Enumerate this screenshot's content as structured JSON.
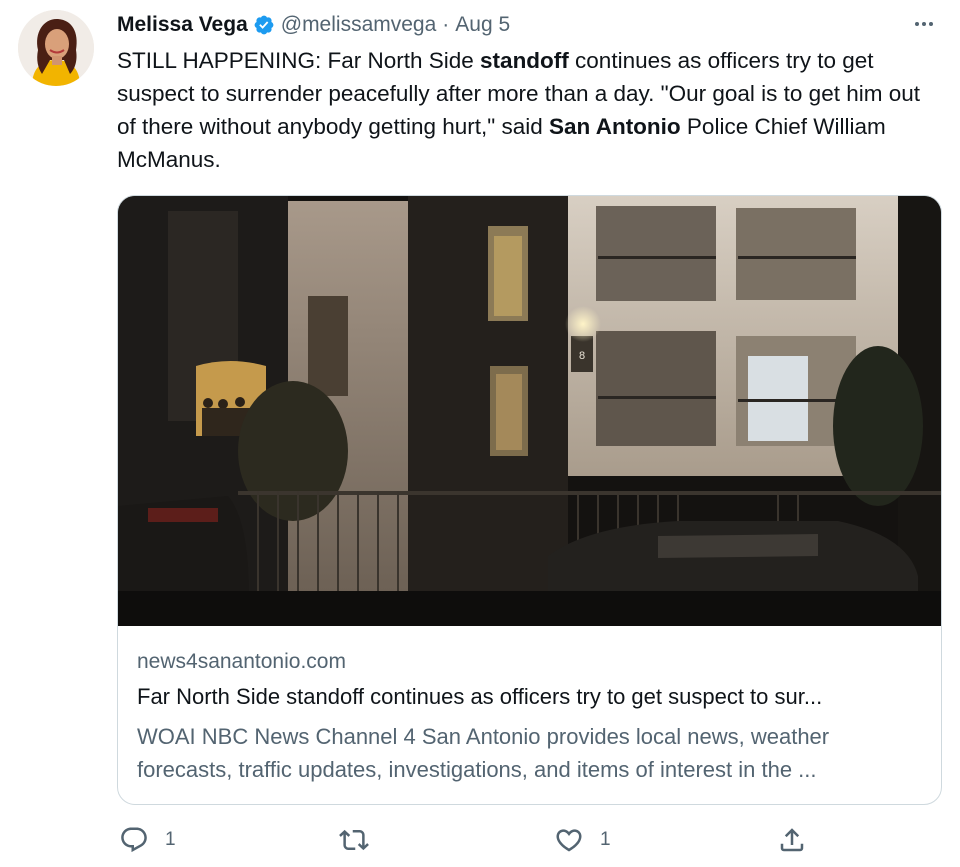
{
  "author": {
    "name": "Melissa Vega",
    "handle": "@melissamvega",
    "separator": "·",
    "date": "Aug 5"
  },
  "tweet": {
    "segments": [
      {
        "text": "STILL HAPPENING: Far North Side ",
        "bold": false
      },
      {
        "text": "standoff",
        "bold": true
      },
      {
        "text": " continues as officers try to get suspect to surrender peacefully after more than a day. \"Our goal is to get him out of there without anybody getting hurt,\" said ",
        "bold": false
      },
      {
        "text": "San Antonio",
        "bold": true
      },
      {
        "text": " Police Chief William McManus.",
        "bold": false
      }
    ]
  },
  "card": {
    "domain": "news4sanantonio.com",
    "title": "Far North Side standoff continues as officers try to get suspect to sur...",
    "description": "WOAI NBC News Channel 4 San Antonio provides local news, weather forecasts, traffic updates, investigations, and items of interest in the ...",
    "image_sign_number": "8"
  },
  "actions": {
    "reply_count": "1",
    "retweet_count": "",
    "like_count": "1"
  },
  "icons": {
    "verified": "verified-badge-icon",
    "more": "more-dots-icon",
    "reply": "reply-icon",
    "retweet": "retweet-icon",
    "like": "heart-icon",
    "share": "share-icon"
  },
  "colors": {
    "verified": "#1d9bf0",
    "text": "#0f1419",
    "secondary": "#536471",
    "border": "#cfd9de"
  }
}
